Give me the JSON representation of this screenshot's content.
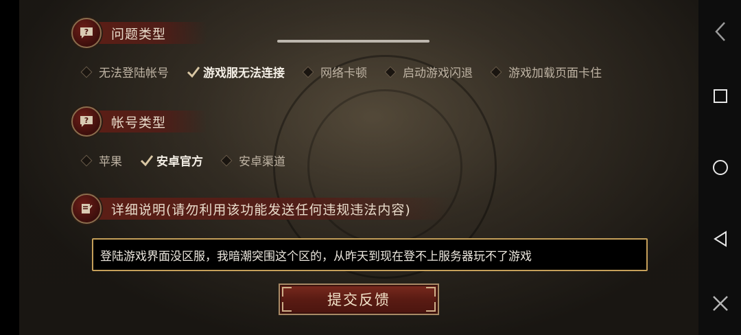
{
  "sections": {
    "issue_type": {
      "title": "问题类型",
      "options": [
        {
          "label": "无法登陆帐号",
          "selected": false
        },
        {
          "label": "游戏服无法连接",
          "selected": true
        },
        {
          "label": "网络卡顿",
          "selected": false
        },
        {
          "label": "启动游戏闪退",
          "selected": false
        },
        {
          "label": "游戏加载页面卡住",
          "selected": false
        }
      ]
    },
    "account_type": {
      "title": "帐号类型",
      "options": [
        {
          "label": "苹果",
          "selected": false
        },
        {
          "label": "安卓官方",
          "selected": true
        },
        {
          "label": "安卓渠道",
          "selected": false
        }
      ]
    },
    "details": {
      "title": "详细说明(请勿利用该功能发送任何违规违法内容)",
      "value": "登陆游戏界面没区服，我暗潮突围这个区的，从昨天到现在登不上服务器玩不了游戏"
    }
  },
  "submit_label": "提交反馈",
  "nav": {
    "back": "back-icon",
    "recent": "square-icon",
    "home": "circle-icon",
    "triangle": "triangle-back-icon",
    "close": "close-icon"
  },
  "colors": {
    "accent_gold": "#c6a05a",
    "header_red": "#5f1e16",
    "button_red": "#6a2217"
  }
}
